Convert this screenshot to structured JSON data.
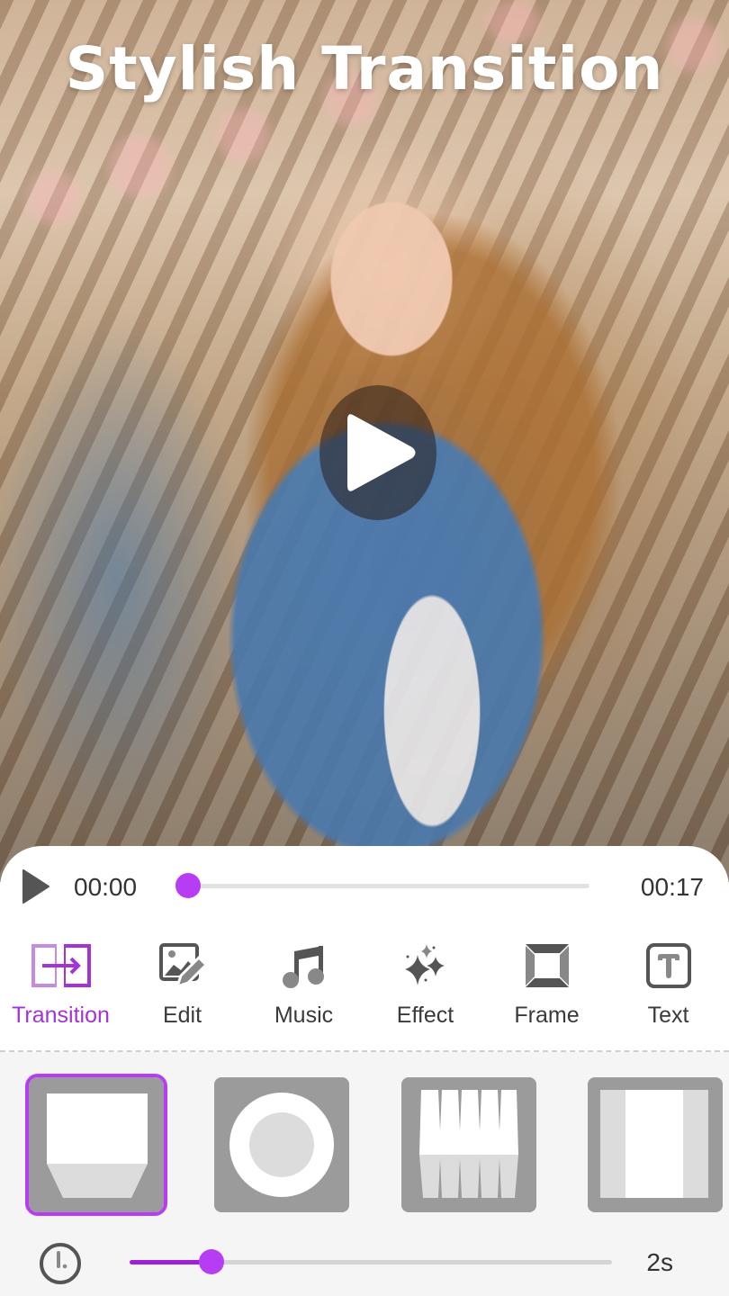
{
  "preview": {
    "title": "Stylish Transition",
    "play_icon": "play-icon"
  },
  "player": {
    "current_time": "00:00",
    "total_time": "00:17",
    "progress": 0.02,
    "play_icon": "play-icon"
  },
  "toolbar": {
    "active_color": "#a333d6",
    "items": [
      {
        "label": "Transition",
        "icon": "transition-icon",
        "active": true
      },
      {
        "label": "Edit",
        "icon": "edit-image-icon",
        "active": false
      },
      {
        "label": "Music",
        "icon": "music-note-icon",
        "active": false
      },
      {
        "label": "Effect",
        "icon": "sparkles-icon",
        "active": false
      },
      {
        "label": "Frame",
        "icon": "frame-icon",
        "active": false
      },
      {
        "label": "Text",
        "icon": "text-icon",
        "active": false
      }
    ]
  },
  "transitions": {
    "selected_index": 0,
    "items": [
      {
        "name": "fold-down"
      },
      {
        "name": "circle-reveal"
      },
      {
        "name": "blinds"
      },
      {
        "name": "split-vertical"
      }
    ]
  },
  "duration": {
    "value_label": "2s",
    "fraction": 0.17,
    "icon": "clock-icon"
  },
  "colors": {
    "accent": "#b73df5",
    "tile_gray": "#9b9b9b"
  }
}
